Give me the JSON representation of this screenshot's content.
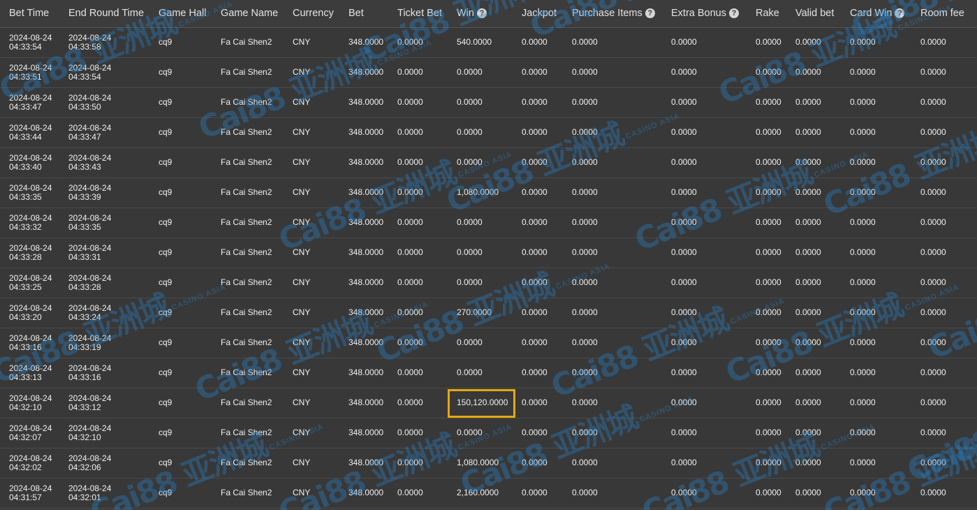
{
  "columns": [
    {
      "label": "Bet Time",
      "help": false
    },
    {
      "label": "End Round Time",
      "help": false
    },
    {
      "label": "Game Hall",
      "help": false
    },
    {
      "label": "Game Name",
      "help": false
    },
    {
      "label": "Currency",
      "help": false
    },
    {
      "label": "Bet",
      "help": false
    },
    {
      "label": "Ticket Bet",
      "help": false
    },
    {
      "label": "Win",
      "help": true
    },
    {
      "label": "Jackpot",
      "help": false
    },
    {
      "label": "Purchase Items",
      "help": true
    },
    {
      "label": "Extra Bonus",
      "help": true
    },
    {
      "label": "Rake",
      "help": false
    },
    {
      "label": "Valid bet",
      "help": false
    },
    {
      "label": "Card Win",
      "help": true
    },
    {
      "label": "Room fee",
      "help": false
    }
  ],
  "help_glyph": "?",
  "highlight_color": "#e5a812",
  "highlighted_row_index": 12,
  "highlighted_column": "Win",
  "watermark": {
    "logo_text": "Cai88 亚洲城",
    "sub_text": "CASINO ASIA",
    "color": "#2882c8"
  },
  "rows": [
    {
      "bet_date": "2024-08-24",
      "bet_time": "04:33:54",
      "end_date": "2024-08-24",
      "end_time": "04:33:58",
      "hall": "cq9",
      "game": "Fa Cai Shen2",
      "currency": "CNY",
      "bet": "348.0000",
      "ticket_bet": "0.0000",
      "win": "540.0000",
      "jackpot": "0.0000",
      "purchase": "0.0000",
      "extra_bonus": "0.0000",
      "rake": "0.0000",
      "valid_bet": "0.0000",
      "card_win": "0.0000",
      "room_fee": "0.0000"
    },
    {
      "bet_date": "2024-08-24",
      "bet_time": "04:33:51",
      "end_date": "2024-08-24",
      "end_time": "04:33:54",
      "hall": "cq9",
      "game": "Fa Cai Shen2",
      "currency": "CNY",
      "bet": "348.0000",
      "ticket_bet": "0.0000",
      "win": "0.0000",
      "jackpot": "0.0000",
      "purchase": "0.0000",
      "extra_bonus": "0.0000",
      "rake": "0.0000",
      "valid_bet": "0.0000",
      "card_win": "0.0000",
      "room_fee": "0.0000"
    },
    {
      "bet_date": "2024-08-24",
      "bet_time": "04:33:47",
      "end_date": "2024-08-24",
      "end_time": "04:33:50",
      "hall": "cq9",
      "game": "Fa Cai Shen2",
      "currency": "CNY",
      "bet": "348.0000",
      "ticket_bet": "0.0000",
      "win": "0.0000",
      "jackpot": "0.0000",
      "purchase": "0.0000",
      "extra_bonus": "0.0000",
      "rake": "0.0000",
      "valid_bet": "0.0000",
      "card_win": "0.0000",
      "room_fee": "0.0000"
    },
    {
      "bet_date": "2024-08-24",
      "bet_time": "04:33:44",
      "end_date": "2024-08-24",
      "end_time": "04:33:47",
      "hall": "cq9",
      "game": "Fa Cai Shen2",
      "currency": "CNY",
      "bet": "348.0000",
      "ticket_bet": "0.0000",
      "win": "0.0000",
      "jackpot": "0.0000",
      "purchase": "0.0000",
      "extra_bonus": "0.0000",
      "rake": "0.0000",
      "valid_bet": "0.0000",
      "card_win": "0.0000",
      "room_fee": "0.0000"
    },
    {
      "bet_date": "2024-08-24",
      "bet_time": "04:33:40",
      "end_date": "2024-08-24",
      "end_time": "04:33:43",
      "hall": "cq9",
      "game": "Fa Cai Shen2",
      "currency": "CNY",
      "bet": "348.0000",
      "ticket_bet": "0.0000",
      "win": "0.0000",
      "jackpot": "0.0000",
      "purchase": "0.0000",
      "extra_bonus": "0.0000",
      "rake": "0.0000",
      "valid_bet": "0.0000",
      "card_win": "0.0000",
      "room_fee": "0.0000"
    },
    {
      "bet_date": "2024-08-24",
      "bet_time": "04:33:35",
      "end_date": "2024-08-24",
      "end_time": "04:33:39",
      "hall": "cq9",
      "game": "Fa Cai Shen2",
      "currency": "CNY",
      "bet": "348.0000",
      "ticket_bet": "0.0000",
      "win": "1,080.0000",
      "jackpot": "0.0000",
      "purchase": "0.0000",
      "extra_bonus": "0.0000",
      "rake": "0.0000",
      "valid_bet": "0.0000",
      "card_win": "0.0000",
      "room_fee": "0.0000"
    },
    {
      "bet_date": "2024-08-24",
      "bet_time": "04:33:32",
      "end_date": "2024-08-24",
      "end_time": "04:33:35",
      "hall": "cq9",
      "game": "Fa Cai Shen2",
      "currency": "CNY",
      "bet": "348.0000",
      "ticket_bet": "0.0000",
      "win": "0.0000",
      "jackpot": "0.0000",
      "purchase": "0.0000",
      "extra_bonus": "0.0000",
      "rake": "0.0000",
      "valid_bet": "0.0000",
      "card_win": "0.0000",
      "room_fee": "0.0000"
    },
    {
      "bet_date": "2024-08-24",
      "bet_time": "04:33:28",
      "end_date": "2024-08-24",
      "end_time": "04:33:31",
      "hall": "cq9",
      "game": "Fa Cai Shen2",
      "currency": "CNY",
      "bet": "348.0000",
      "ticket_bet": "0.0000",
      "win": "0.0000",
      "jackpot": "0.0000",
      "purchase": "0.0000",
      "extra_bonus": "0.0000",
      "rake": "0.0000",
      "valid_bet": "0.0000",
      "card_win": "0.0000",
      "room_fee": "0.0000"
    },
    {
      "bet_date": "2024-08-24",
      "bet_time": "04:33:25",
      "end_date": "2024-08-24",
      "end_time": "04:33:28",
      "hall": "cq9",
      "game": "Fa Cai Shen2",
      "currency": "CNY",
      "bet": "348.0000",
      "ticket_bet": "0.0000",
      "win": "0.0000",
      "jackpot": "0.0000",
      "purchase": "0.0000",
      "extra_bonus": "0.0000",
      "rake": "0.0000",
      "valid_bet": "0.0000",
      "card_win": "0.0000",
      "room_fee": "0.0000"
    },
    {
      "bet_date": "2024-08-24",
      "bet_time": "04:33:20",
      "end_date": "2024-08-24",
      "end_time": "04:33:24",
      "hall": "cq9",
      "game": "Fa Cai Shen2",
      "currency": "CNY",
      "bet": "348.0000",
      "ticket_bet": "0.0000",
      "win": "270.0000",
      "jackpot": "0.0000",
      "purchase": "0.0000",
      "extra_bonus": "0.0000",
      "rake": "0.0000",
      "valid_bet": "0.0000",
      "card_win": "0.0000",
      "room_fee": "0.0000"
    },
    {
      "bet_date": "2024-08-24",
      "bet_time": "04:33:16",
      "end_date": "2024-08-24",
      "end_time": "04:33:19",
      "hall": "cq9",
      "game": "Fa Cai Shen2",
      "currency": "CNY",
      "bet": "348.0000",
      "ticket_bet": "0.0000",
      "win": "0.0000",
      "jackpot": "0.0000",
      "purchase": "0.0000",
      "extra_bonus": "0.0000",
      "rake": "0.0000",
      "valid_bet": "0.0000",
      "card_win": "0.0000",
      "room_fee": "0.0000"
    },
    {
      "bet_date": "2024-08-24",
      "bet_time": "04:33:13",
      "end_date": "2024-08-24",
      "end_time": "04:33:16",
      "hall": "cq9",
      "game": "Fa Cai Shen2",
      "currency": "CNY",
      "bet": "348.0000",
      "ticket_bet": "0.0000",
      "win": "0.0000",
      "jackpot": "0.0000",
      "purchase": "0.0000",
      "extra_bonus": "0.0000",
      "rake": "0.0000",
      "valid_bet": "0.0000",
      "card_win": "0.0000",
      "room_fee": "0.0000"
    },
    {
      "bet_date": "2024-08-24",
      "bet_time": "04:32:10",
      "end_date": "2024-08-24",
      "end_time": "04:33:12",
      "hall": "cq9",
      "game": "Fa Cai Shen2",
      "currency": "CNY",
      "bet": "348.0000",
      "ticket_bet": "0.0000",
      "win": "150,120.0000",
      "jackpot": "0.0000",
      "purchase": "0.0000",
      "extra_bonus": "0.0000",
      "rake": "0.0000",
      "valid_bet": "0.0000",
      "card_win": "0.0000",
      "room_fee": "0.0000"
    },
    {
      "bet_date": "2024-08-24",
      "bet_time": "04:32:07",
      "end_date": "2024-08-24",
      "end_time": "04:32:10",
      "hall": "cq9",
      "game": "Fa Cai Shen2",
      "currency": "CNY",
      "bet": "348.0000",
      "ticket_bet": "0.0000",
      "win": "0.0000",
      "jackpot": "0.0000",
      "purchase": "0.0000",
      "extra_bonus": "0.0000",
      "rake": "0.0000",
      "valid_bet": "0.0000",
      "card_win": "0.0000",
      "room_fee": "0.0000"
    },
    {
      "bet_date": "2024-08-24",
      "bet_time": "04:32:02",
      "end_date": "2024-08-24",
      "end_time": "04:32:06",
      "hall": "cq9",
      "game": "Fa Cai Shen2",
      "currency": "CNY",
      "bet": "348.0000",
      "ticket_bet": "0.0000",
      "win": "1,080.0000",
      "jackpot": "0.0000",
      "purchase": "0.0000",
      "extra_bonus": "0.0000",
      "rake": "0.0000",
      "valid_bet": "0.0000",
      "card_win": "0.0000",
      "room_fee": "0.0000"
    },
    {
      "bet_date": "2024-08-24",
      "bet_time": "04:31:57",
      "end_date": "2024-08-24",
      "end_time": "04:32:01",
      "hall": "cq9",
      "game": "Fa Cai Shen2",
      "currency": "CNY",
      "bet": "348.0000",
      "ticket_bet": "0.0000",
      "win": "2,160.0000",
      "jackpot": "0.0000",
      "purchase": "0.0000",
      "extra_bonus": "0.0000",
      "rake": "0.0000",
      "valid_bet": "0.0000",
      "card_win": "0.0000",
      "room_fee": "0.0000"
    }
  ]
}
